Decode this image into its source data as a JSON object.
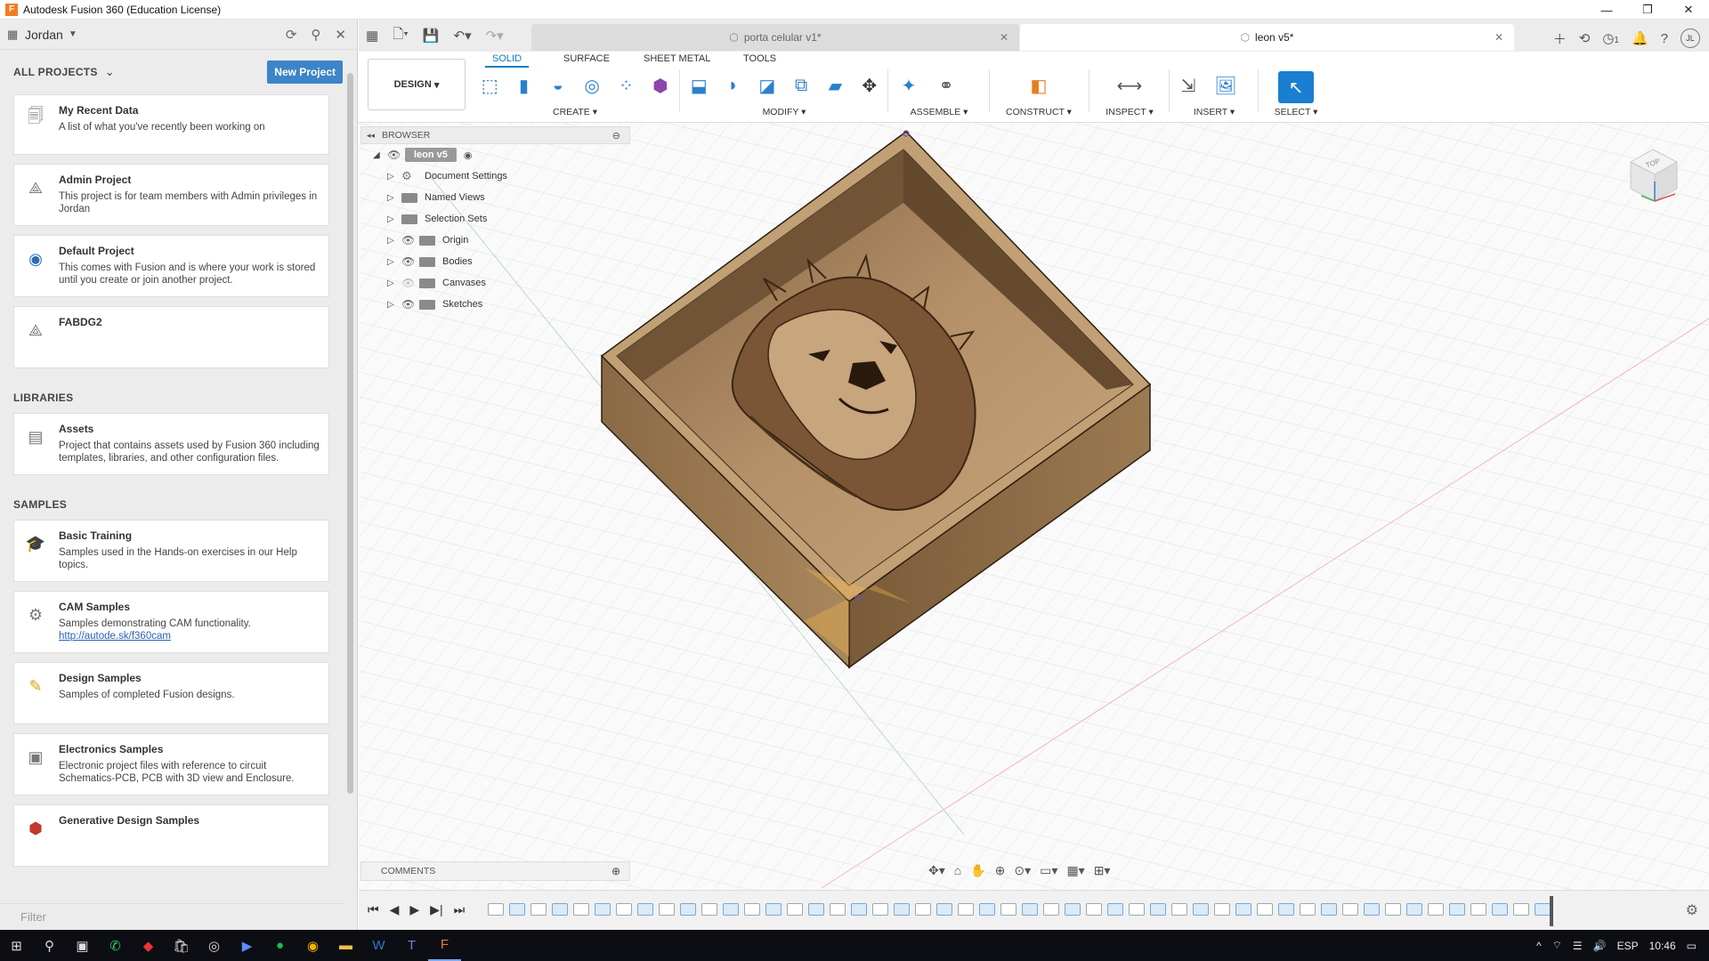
{
  "window": {
    "title": "Autodesk Fusion 360 (Education License)",
    "app_icon": "F"
  },
  "datapanel": {
    "user": "Jordan",
    "all_projects": "ALL PROJECTS",
    "new_project": "New Project",
    "projects": [
      {
        "title": "My Recent Data",
        "desc": "A list of what you've recently been working on"
      },
      {
        "title": "Admin Project",
        "desc": "This project is for team members with Admin privileges in Jordan"
      },
      {
        "title": "Default Project",
        "desc": "This comes with Fusion and is where your work is stored until you create or join another project."
      },
      {
        "title": "FABDG2",
        "desc": ""
      }
    ],
    "libraries_title": "LIBRARIES",
    "libraries": [
      {
        "title": "Assets",
        "desc": "Project that contains assets used by Fusion 360 including templates, libraries, and other configuration files."
      }
    ],
    "samples_title": "SAMPLES",
    "samples": [
      {
        "title": "Basic Training",
        "desc": "Samples used in the Hands-on exercises in our Help topics.",
        "link": ""
      },
      {
        "title": "CAM Samples",
        "desc": "Samples demonstrating CAM functionality.",
        "link": "http://autode.sk/f360cam"
      },
      {
        "title": "Design Samples",
        "desc": "Samples of completed Fusion designs.",
        "link": ""
      },
      {
        "title": "Electronics Samples",
        "desc": "Electronic project files with reference to circuit Schematics-PCB, PCB with 3D view and Enclosure.",
        "link": ""
      },
      {
        "title": "Generative Design Samples",
        "desc": "",
        "link": ""
      }
    ],
    "filter_placeholder": "Filter"
  },
  "tabs": {
    "inactive": "porta celular v1*",
    "active": "leon v5*",
    "notification_count": "1",
    "avatar": "JL"
  },
  "toolbar": {
    "workspace": "DESIGN",
    "tabs": [
      "SOLID",
      "SURFACE",
      "SHEET METAL",
      "TOOLS"
    ],
    "groups": {
      "create": "CREATE",
      "modify": "MODIFY",
      "assemble": "ASSEMBLE",
      "construct": "CONSTRUCT",
      "inspect": "INSPECT",
      "insert": "INSERT",
      "select": "SELECT"
    }
  },
  "browser": {
    "title": "BROWSER",
    "root": "leon v5",
    "nodes": [
      "Document Settings",
      "Named Views",
      "Selection Sets",
      "Origin",
      "Bodies",
      "Canvases",
      "Sketches"
    ]
  },
  "viewcube": {
    "face": "TOP"
  },
  "comments": {
    "title": "COMMENTS"
  },
  "taskbar": {
    "lang": "ESP",
    "time": "10:46"
  },
  "colors": {
    "accent": "#0b7ec3",
    "new_project_bg": "#3c85c8",
    "wood_light": "#b08e63",
    "wood_dark": "#6b4e30"
  }
}
